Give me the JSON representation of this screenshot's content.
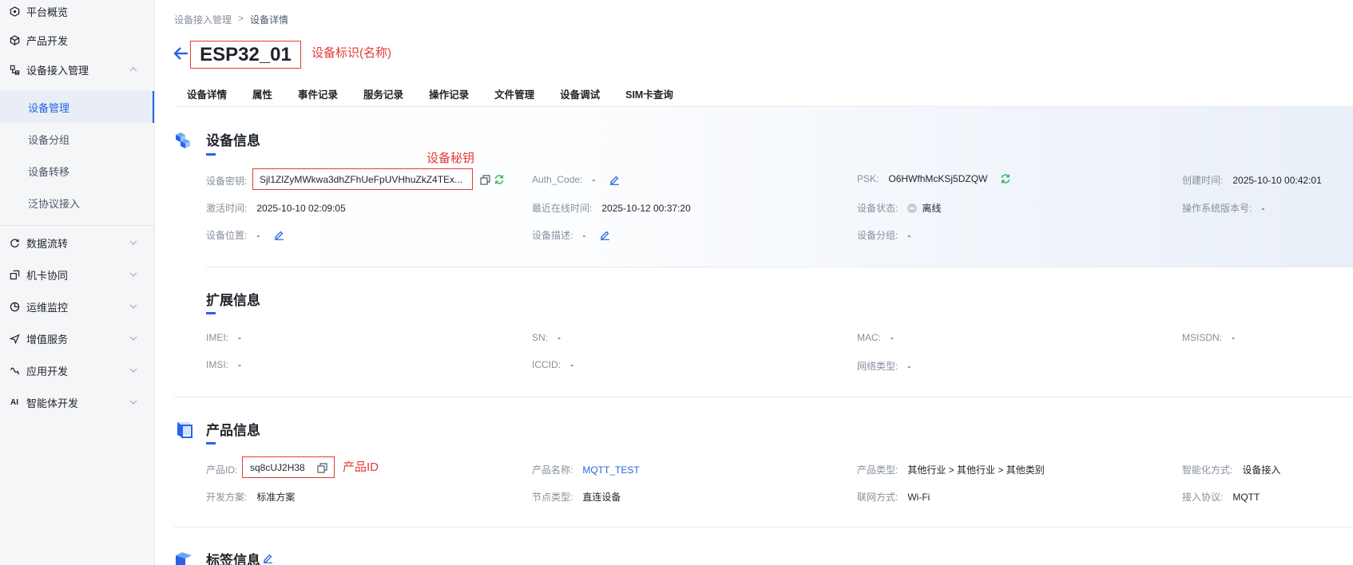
{
  "sidebar": {
    "items": [
      {
        "label": "平台概览"
      },
      {
        "label": "产品开发"
      },
      {
        "label": "设备接入管理"
      },
      {
        "label": "数据流转"
      },
      {
        "label": "机卡协同"
      },
      {
        "label": "运维监控"
      },
      {
        "label": "增值服务"
      },
      {
        "label": "应用开发"
      },
      {
        "label": "智能体开发"
      }
    ],
    "sub_items": [
      {
        "label": "设备管理",
        "active": true
      },
      {
        "label": "设备分组"
      },
      {
        "label": "设备转移"
      },
      {
        "label": "泛协议接入"
      }
    ]
  },
  "breadcrumb": {
    "parent": "设备接入管理",
    "separator": ">",
    "current": "设备详情"
  },
  "header": {
    "device_name": "ESP32_01",
    "annotation_name": "设备标识(名称)"
  },
  "tabs": [
    "设备详情",
    "属性",
    "事件记录",
    "服务记录",
    "操作记录",
    "文件管理",
    "设备调试",
    "SIM卡查询"
  ],
  "device_info": {
    "title": "设备信息",
    "annotation_secret": "设备秘钥",
    "secret_label": "设备密钥:",
    "secret_value": "Sjl1ZlZyMWkwa3dhZFhUeFpUVHhuZkZ4TEx...",
    "auth_code_label": "Auth_Code:",
    "auth_code_value": "-",
    "psk_label": "PSK:",
    "psk_value": "O6HWfhMcKSj5DZQW",
    "created_label": "创建时间:",
    "created_value": "2025-10-10 00:42:01",
    "activated_label": "激活时间:",
    "activated_value": "2025-10-10 02:09:05",
    "last_online_label": "最近在线时间:",
    "last_online_value": "2025-10-12 00:37:20",
    "status_label": "设备状态:",
    "status_value": "离线",
    "os_label": "操作系统版本号:",
    "os_value": "-",
    "location_label": "设备位置:",
    "location_value": "-",
    "desc_label": "设备描述:",
    "desc_value": "-",
    "group_label": "设备分组:",
    "group_value": "-"
  },
  "ext_info": {
    "title": "扩展信息",
    "imei_label": "IMEI:",
    "imei_value": "-",
    "sn_label": "SN:",
    "sn_value": "-",
    "mac_label": "MAC:",
    "mac_value": "-",
    "msisdn_label": "MSISDN:",
    "msisdn_value": "-",
    "imsi_label": "IMSI:",
    "imsi_value": "-",
    "iccid_label": "ICCID:",
    "iccid_value": "-",
    "net_label": "网络类型:",
    "net_value": "-"
  },
  "product_info": {
    "title": "产品信息",
    "annotation_pid": "产品ID",
    "pid_label": "产品ID:",
    "pid_value": "sq8cUJ2H38",
    "name_label": "产品名称:",
    "name_value": "MQTT_TEST",
    "type_label": "产品类型:",
    "type_value": "其他行业 > 其他行业 > 其他类别",
    "smart_label": "智能化方式:",
    "smart_value": "设备接入",
    "dev_label": "开发方案:",
    "dev_value": "标准方案",
    "node_label": "节点类型:",
    "node_value": "直连设备",
    "netmode_label": "联网方式:",
    "netmode_value": "Wi-Fi",
    "protocol_label": "接入协议:",
    "protocol_value": "MQTT"
  },
  "tag_info": {
    "title": "标签信息"
  },
  "colors": {
    "accent": "#2a63e6",
    "annotation": "#e53935",
    "refresh": "#2db55d"
  }
}
